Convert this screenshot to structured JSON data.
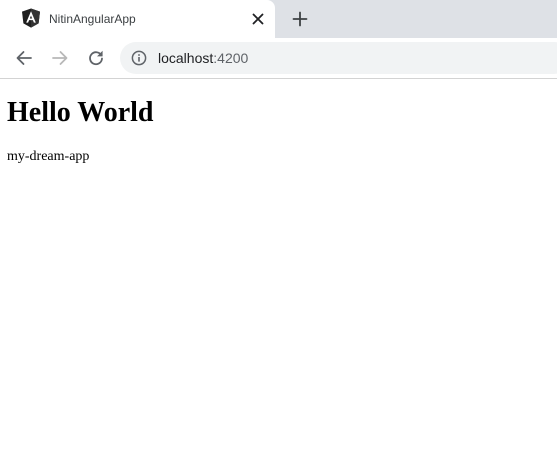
{
  "tab": {
    "title": "NitinAngularApp",
    "favicon": "angular-logo-icon",
    "close_icon": "close-icon"
  },
  "toolbar": {
    "back_icon": "arrow-left-icon",
    "forward_icon": "arrow-right-icon",
    "reload_icon": "reload-icon",
    "new_tab_icon": "plus-icon"
  },
  "address_bar": {
    "host": "localhost",
    "port": ":4200",
    "site_info_icon": "info-icon"
  },
  "page": {
    "heading": "Hello World",
    "text": "my-dream-app"
  },
  "colors": {
    "tabstrip": "#dee1e6",
    "omnibox": "#f1f3f4",
    "icon": "#5f6368",
    "icon_disabled": "#b8b8b8"
  }
}
